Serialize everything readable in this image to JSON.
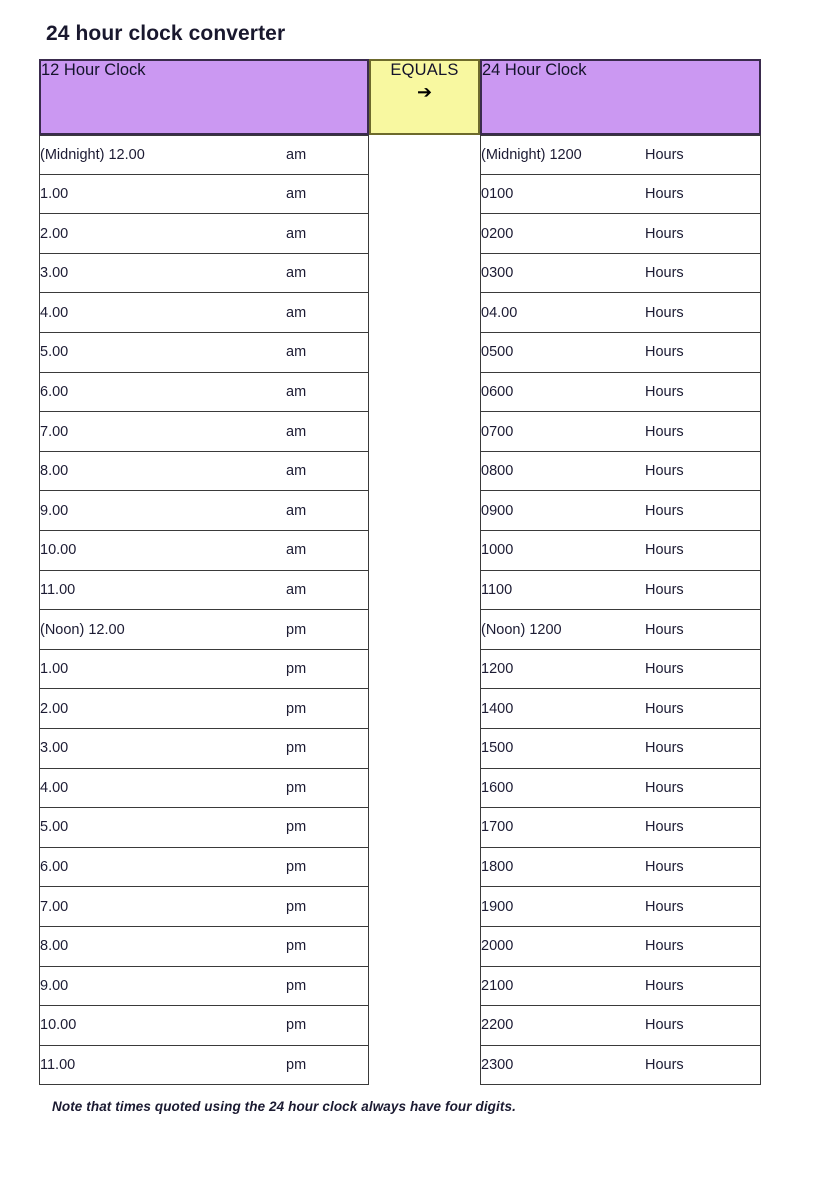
{
  "document": {
    "title": "24 hour clock converter",
    "footnote": "Note that times quoted using the 24 hour clock always have four digits."
  },
  "colors": {
    "header_purple": "#cb98f2",
    "header_yellow": "#f8f8a0",
    "header_border": "#3a2b4d",
    "cell_border": "#3a3a3a",
    "text": "#1c1b33"
  },
  "table": {
    "headers": {
      "twelve_hour": "12 Hour Clock",
      "equals": "EQUALS",
      "equals_arrow": "➔",
      "twentyfour_hour": "24 Hour Clock"
    },
    "rows": [
      {
        "time12": "(Midnight) 12.00",
        "meridiem": "am",
        "time24": "(Midnight) 1200",
        "unit": "Hours"
      },
      {
        "time12": "1.00",
        "meridiem": "am",
        "time24": "0100",
        "unit": "Hours"
      },
      {
        "time12": "2.00",
        "meridiem": "am",
        "time24": "0200",
        "unit": "Hours"
      },
      {
        "time12": "3.00",
        "meridiem": "am",
        "time24": "0300",
        "unit": "Hours"
      },
      {
        "time12": "4.00",
        "meridiem": "am",
        "time24": "04.00",
        "unit": "Hours"
      },
      {
        "time12": "5.00",
        "meridiem": "am",
        "time24": "0500",
        "unit": "Hours"
      },
      {
        "time12": "6.00",
        "meridiem": "am",
        "time24": "0600",
        "unit": "Hours"
      },
      {
        "time12": "7.00",
        "meridiem": "am",
        "time24": "0700",
        "unit": "Hours"
      },
      {
        "time12": "8.00",
        "meridiem": "am",
        "time24": "0800",
        "unit": "Hours"
      },
      {
        "time12": "9.00",
        "meridiem": "am",
        "time24": "0900",
        "unit": "Hours"
      },
      {
        "time12": "10.00",
        "meridiem": "am",
        "time24": "1000",
        "unit": "Hours"
      },
      {
        "time12": "11.00",
        "meridiem": "am",
        "time24": "1100",
        "unit": "Hours"
      },
      {
        "time12": "(Noon) 12.00",
        "meridiem": "pm",
        "time24": "(Noon) 1200",
        "unit": "Hours"
      },
      {
        "time12": "1.00",
        "meridiem": "pm",
        "time24": "1200",
        "unit": "Hours"
      },
      {
        "time12": "2.00",
        "meridiem": "pm",
        "time24": "1400",
        "unit": "Hours"
      },
      {
        "time12": "3.00",
        "meridiem": "pm",
        "time24": "1500",
        "unit": "Hours"
      },
      {
        "time12": "4.00",
        "meridiem": "pm",
        "time24": "1600",
        "unit": "Hours"
      },
      {
        "time12": "5.00",
        "meridiem": "pm",
        "time24": "1700",
        "unit": "Hours"
      },
      {
        "time12": "6.00",
        "meridiem": "pm",
        "time24": "1800",
        "unit": "Hours"
      },
      {
        "time12": "7.00",
        "meridiem": "pm",
        "time24": "1900",
        "unit": "Hours"
      },
      {
        "time12": "8.00",
        "meridiem": "pm",
        "time24": "2000",
        "unit": "Hours"
      },
      {
        "time12": "9.00",
        "meridiem": "pm",
        "time24": "2100",
        "unit": "Hours"
      },
      {
        "time12": "10.00",
        "meridiem": "pm",
        "time24": "2200",
        "unit": "Hours"
      },
      {
        "time12": "11.00",
        "meridiem": "pm",
        "time24": "2300",
        "unit": "Hours"
      }
    ]
  }
}
